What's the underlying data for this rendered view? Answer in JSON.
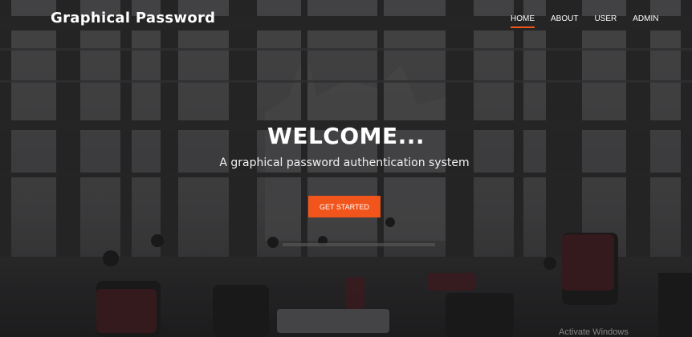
{
  "navbar": {
    "brand": "Graphical Password",
    "items": [
      {
        "label": "HOME",
        "active": true
      },
      {
        "label": "ABOUT",
        "active": false
      },
      {
        "label": "USER",
        "active": false
      },
      {
        "label": "ADMIN",
        "active": false
      }
    ]
  },
  "hero": {
    "headline": "WELCOME...",
    "subtitle": "A graphical password authentication system",
    "cta_label": "GET STARTED",
    "background_image": "atrium-background-photo"
  },
  "system": {
    "watermark": "Activate Windows"
  },
  "colors": {
    "accent": "#f1551c",
    "text": "#ffffff",
    "overlay": "#2e2e30"
  }
}
